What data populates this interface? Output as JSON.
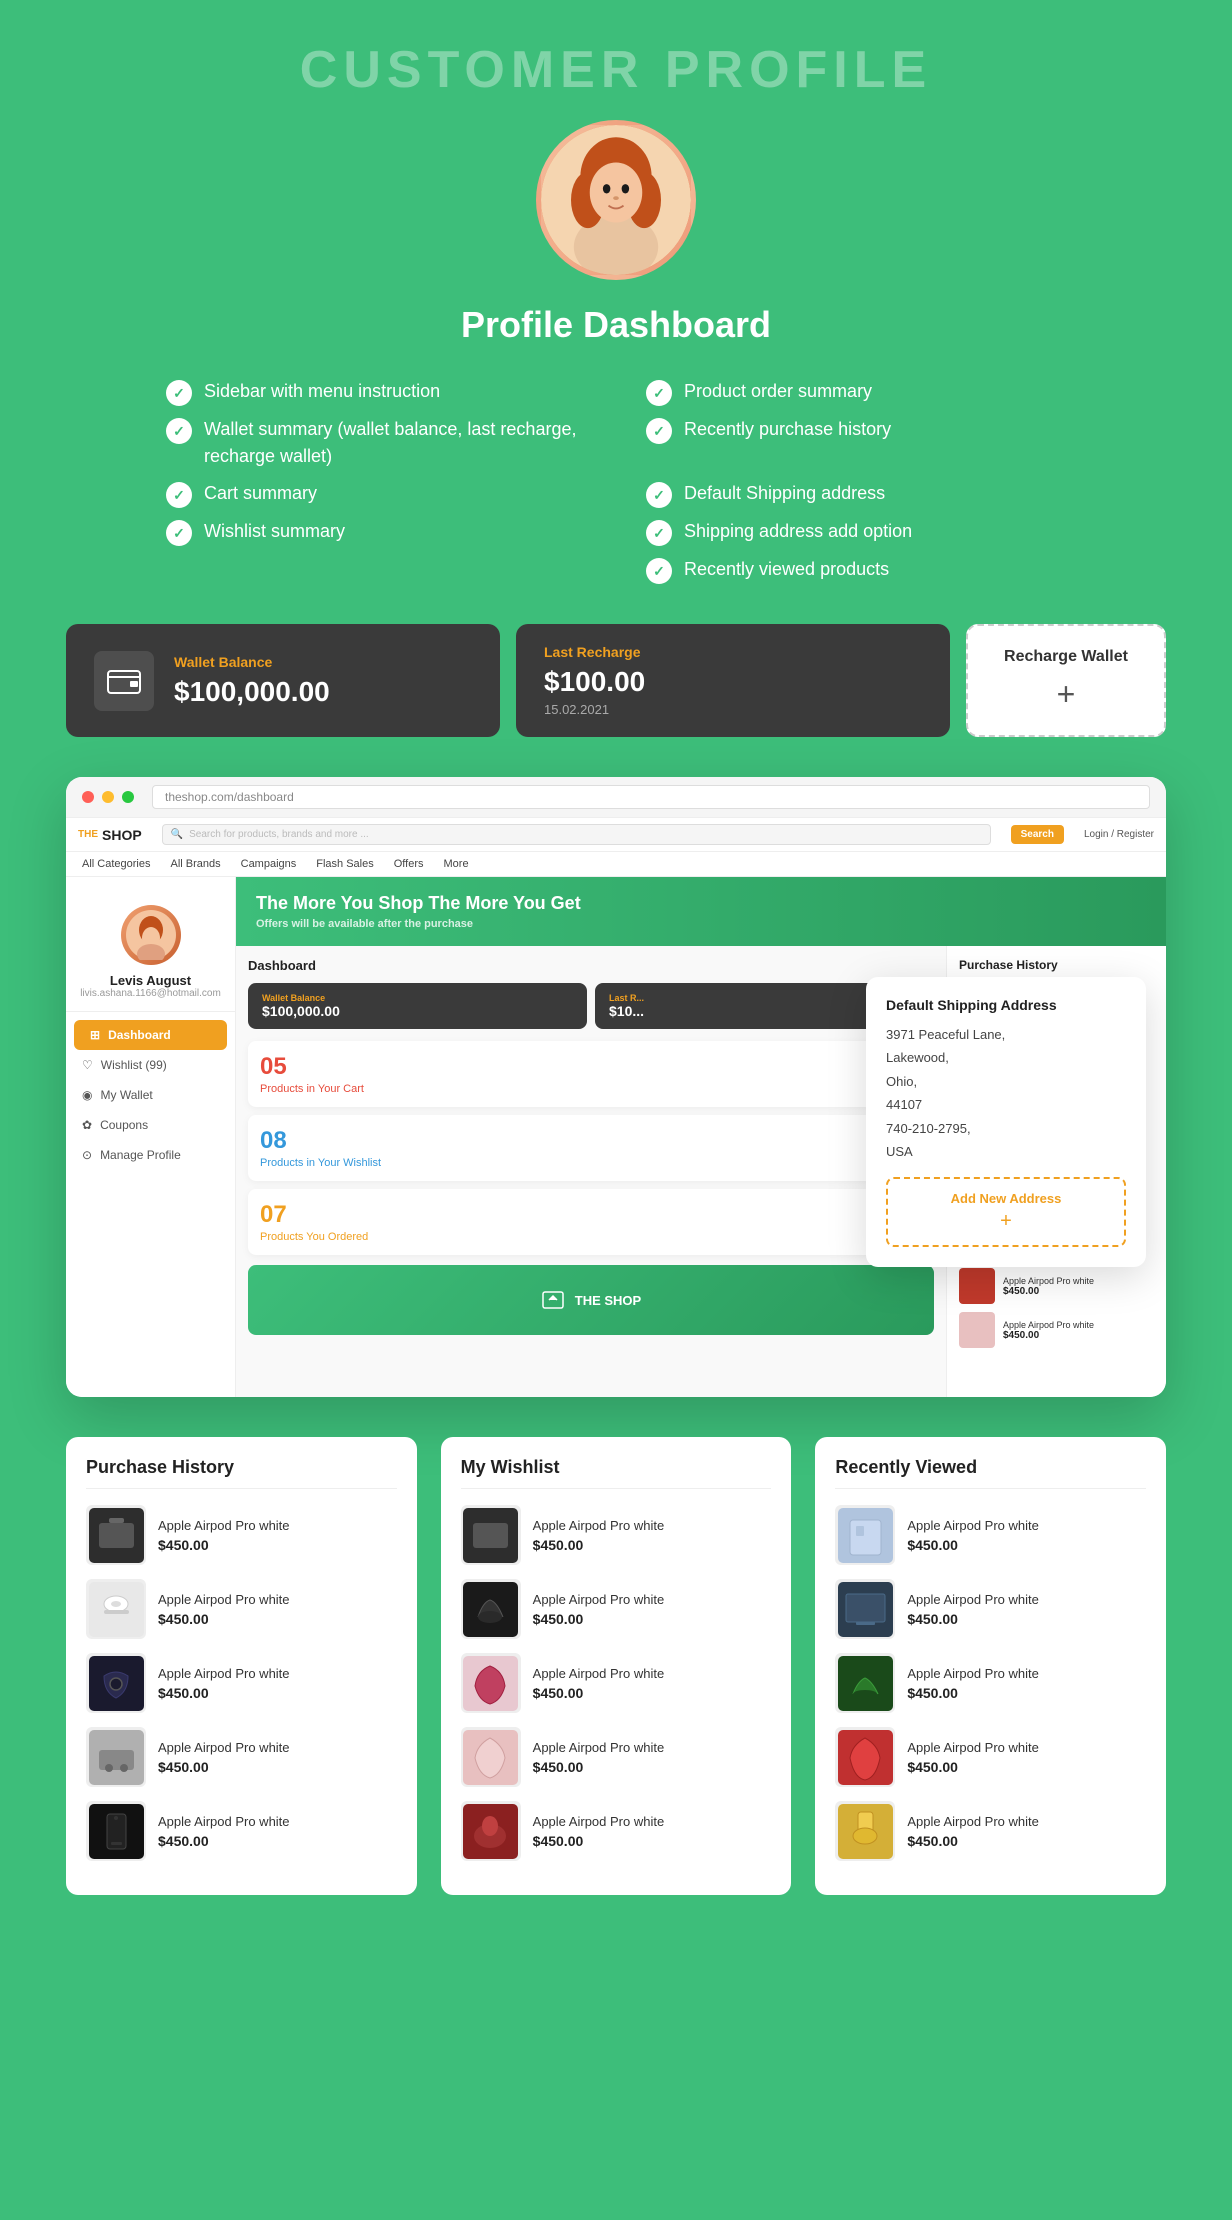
{
  "page": {
    "title": "CUSTOMER PROFILE",
    "dashboard_title": "Profile Dashboard",
    "features": [
      {
        "id": "feat1",
        "text": "Sidebar with menu instruction"
      },
      {
        "id": "feat2",
        "text": "Wallet summary (wallet balance, last recharge, recharge wallet)"
      },
      {
        "id": "feat3",
        "text": "Cart summary"
      },
      {
        "id": "feat4",
        "text": "Wishlist summary"
      },
      {
        "id": "feat5",
        "text": "Product order summary"
      },
      {
        "id": "feat6",
        "text": "Recently purchase history"
      },
      {
        "id": "feat7",
        "text": "Default Shipping address"
      },
      {
        "id": "feat8",
        "text": "Shipping address add option"
      },
      {
        "id": "feat9",
        "text": "Recently viewed products"
      }
    ]
  },
  "wallet": {
    "balance_label": "Wallet Balance",
    "balance_amount": "$100,000.00",
    "recharge_label": "Last Recharge",
    "recharge_amount": "$100.00",
    "recharge_date": "15.02.2021",
    "recharge_wallet_label": "Recharge Wallet",
    "plus": "+"
  },
  "mockup": {
    "shop_the": "THE",
    "shop_name": "SHOP",
    "search_placeholder": "Search for products, brands and more ...",
    "search_btn": "Search",
    "nav_items": [
      "All Categories",
      "All Brands",
      "Campaigns",
      "Flash Sales",
      "Offers",
      "More"
    ],
    "hero_text": "The More You Shop The More You Get",
    "hero_sub": "Offers will be available after the purchase",
    "dashboard_label": "Dashboard",
    "wallet_label": "Wallet Balance",
    "wallet_amount": "$100,000.00",
    "last_recharge_label": "Last R...",
    "user_name": "Levis August",
    "user_email": "livis.ashana.1166@hotmail.com",
    "nav_items_sidebar": [
      {
        "label": "Wishlist (99)",
        "icon": "♡",
        "active": false
      },
      {
        "label": "My Wallet",
        "icon": "◉",
        "active": false
      },
      {
        "label": "Coupons",
        "icon": "✿",
        "active": false
      },
      {
        "label": "Manage Profile",
        "icon": "⊙",
        "active": false
      }
    ],
    "active_nav": "Dashboard",
    "stats": [
      {
        "number": "05",
        "label": "Products in Your Cart",
        "color": "#e74c3c"
      },
      {
        "number": "08",
        "label": "Products in Your Wishlist",
        "color": "#3498db"
      },
      {
        "number": "07",
        "label": "Products You Ordered",
        "color": "#f0a020"
      }
    ],
    "purchase_history_label": "Purchase History",
    "wishlist_label": "My Wishlist"
  },
  "shipping": {
    "title": "Default Shipping Address",
    "line1": "3971 Peaceful Lane,",
    "line2": "Lakewood,",
    "line3": "Ohio,",
    "line4": "44107",
    "line5": "740-210-2795,",
    "line6": "USA",
    "add_label": "Add New Address",
    "plus": "+"
  },
  "purchase_history": {
    "title": "Purchase History",
    "items": [
      {
        "name": "Apple Airpod Pro white",
        "price": "$450.00",
        "thumb_color": "#2d2d2d"
      },
      {
        "name": "Apple Airpod Pro white",
        "price": "$450.00",
        "thumb_color": "#e0e0e0"
      },
      {
        "name": "Apple Airpod Pro white",
        "price": "$450.00",
        "thumb_color": "#1a1a2e"
      },
      {
        "name": "Apple Airpod Pro white",
        "price": "$450.00",
        "thumb_color": "#444"
      },
      {
        "name": "Apple Airpod Pro white",
        "price": "$450.00",
        "thumb_color": "#111"
      }
    ]
  },
  "wishlist": {
    "title": "My Wishlist",
    "items": [
      {
        "name": "Apple Airpod Pro white",
        "price": "$450.00",
        "thumb_color": "#2d2d2d"
      },
      {
        "name": "Apple Airpod Pro white",
        "price": "$450.00",
        "thumb_color": "#1a1a1a"
      },
      {
        "name": "Apple Airpod Pro white",
        "price": "$450.00",
        "thumb_color": "#c0392b"
      },
      {
        "name": "Apple Airpod Pro white",
        "price": "$450.00",
        "thumb_color": "#e8c0c0"
      },
      {
        "name": "Apple Airpod Pro white",
        "price": "$450.00",
        "thumb_color": "#8b0000"
      }
    ]
  },
  "recently_viewed": {
    "title": "Recently Viewed",
    "items": [
      {
        "name": "Apple Airpod Pro white",
        "price": "$450.00",
        "thumb_color": "#b0c4de"
      },
      {
        "name": "Apple Airpod Pro white",
        "price": "$450.00",
        "thumb_color": "#2c3e50"
      },
      {
        "name": "Apple Airpod Pro white",
        "price": "$450.00",
        "thumb_color": "#1a8c1a"
      },
      {
        "name": "Apple Airpod Pro white",
        "price": "$450.00",
        "thumb_color": "#c0392b"
      },
      {
        "name": "Apple Airpod Pro white",
        "price": "$450.00",
        "thumb_color": "#d4af37"
      }
    ]
  }
}
